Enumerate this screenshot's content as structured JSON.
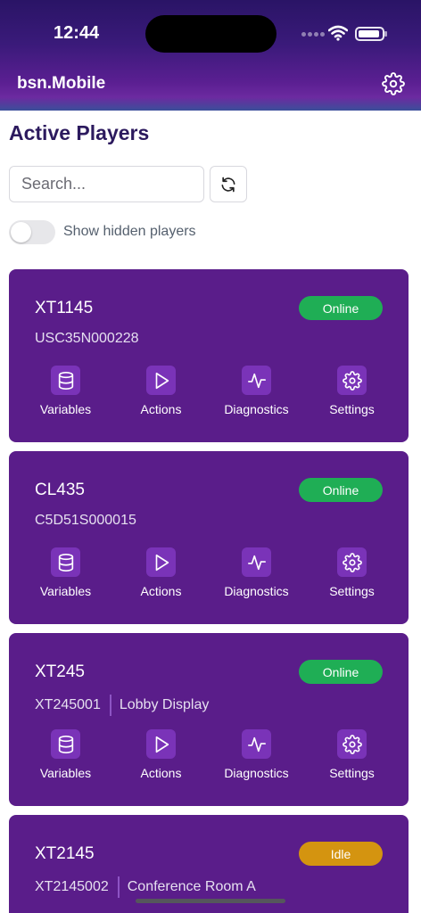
{
  "status_bar": {
    "time": "12:44"
  },
  "header": {
    "app_title": "bsn.Mobile"
  },
  "page_title": "Active Players",
  "search": {
    "placeholder": "Search...",
    "value": ""
  },
  "toggle": {
    "label": "Show hidden players",
    "on": false
  },
  "action_labels": {
    "variables": "Variables",
    "actions": "Actions",
    "diagnostics": "Diagnostics",
    "settings": "Settings"
  },
  "players": [
    {
      "name": "XT1145",
      "serial": "USC35N000228",
      "location": "",
      "status": "Online"
    },
    {
      "name": "CL435",
      "serial": "C5D51S000015",
      "location": "",
      "status": "Online"
    },
    {
      "name": "XT245",
      "serial": "XT245001",
      "location": "Lobby Display",
      "status": "Online"
    },
    {
      "name": "XT2145",
      "serial": "XT2145002",
      "location": "Conference Room A",
      "status": "Idle"
    }
  ],
  "colors": {
    "online": "#1fae55",
    "idle": "#d49410",
    "card": "#5a1d8a",
    "title": "#2c1a5e"
  },
  "icons": [
    "gear-icon",
    "refresh-icon",
    "database-icon",
    "play-icon",
    "pulse-icon",
    "wifi-icon",
    "battery-icon"
  ]
}
